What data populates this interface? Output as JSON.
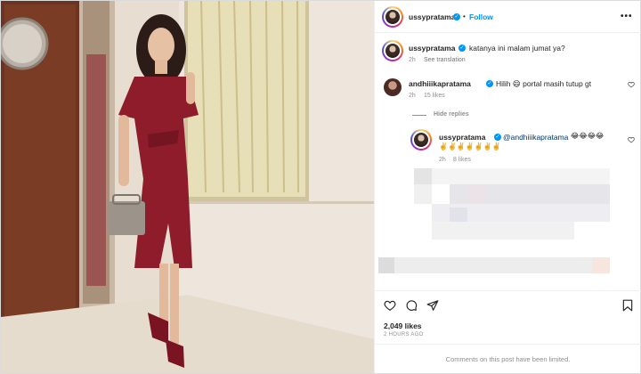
{
  "post": {
    "author": "ussypratama",
    "separator": "•",
    "follow_label": "Follow",
    "more_label": "•••",
    "image_alt": "Woman in a red wrap dress standing beside a marble wall and framed painting"
  },
  "caption": {
    "username": "ussypratama",
    "text": "katanya ini malam jumat ya?",
    "time": "2h",
    "translate_label": "See translation"
  },
  "comments": [
    {
      "username": "andhiiikapratama",
      "text": "Hilih 😄 portal masih tutup gt",
      "time": "2h",
      "likes": "15 likes"
    }
  ],
  "hide_replies_label": "Hide replies",
  "reply": {
    "username": "ussypratama",
    "mention": "@andhiiikapratama",
    "emojis_line1": "😂😂😂😂",
    "emojis_line2": "✌️✌️✌️✌️✌️✌️✌️",
    "time": "2h",
    "likes": "8 likes"
  },
  "stats": {
    "likes": "2,049 likes",
    "posted": "2 HOURS AGO"
  },
  "footer": {
    "limited_text": "Comments on this post have been limited."
  },
  "colors": {
    "accent_blue": "#0095f6",
    "text": "#262626",
    "muted": "#8e8e8e",
    "dress": "#8e1c2b"
  }
}
